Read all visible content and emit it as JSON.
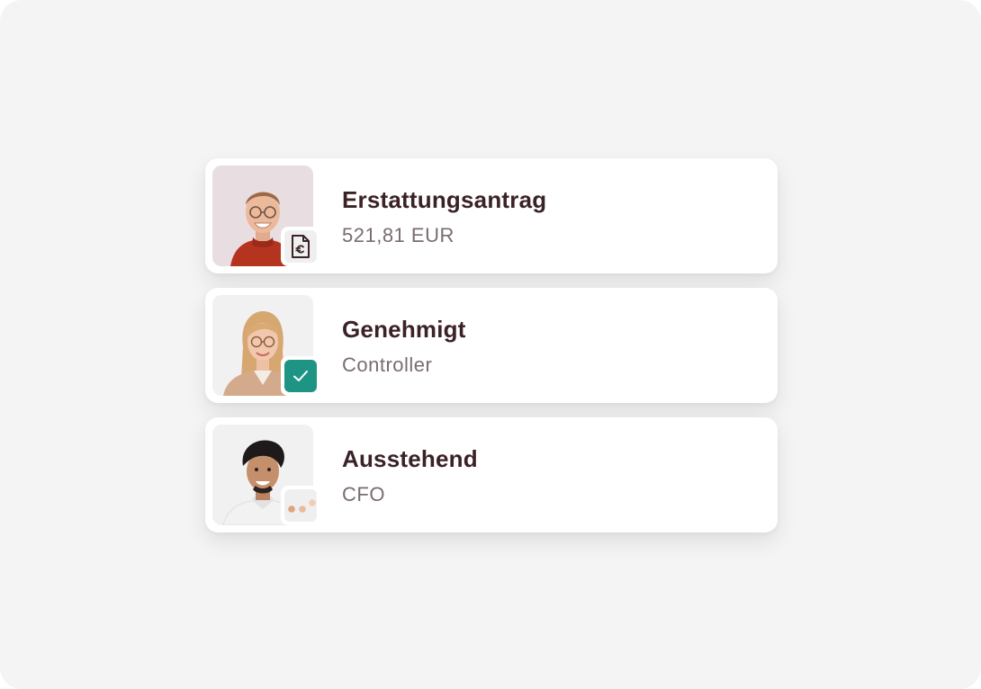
{
  "colors": {
    "page_background": "#f4f4f4",
    "card_background": "#ffffff",
    "title_text": "#3a2226",
    "subtitle_text": "#7a6c6f",
    "approved_badge": "#1e9484",
    "neutral_badge": "#efefef",
    "pending_dots": "#e0a27f"
  },
  "cards": [
    {
      "title": "Erstattungsantrag",
      "subtitle": "521,81 EUR",
      "badge_icon": "euro-document-icon",
      "avatar": "avatar-man-glasses"
    },
    {
      "title": "Genehmigt",
      "subtitle": "Controller",
      "badge_icon": "check-icon",
      "avatar": "avatar-woman-glasses"
    },
    {
      "title": "Ausstehend",
      "subtitle": "CFO",
      "badge_icon": "pending-dots-icon",
      "avatar": "avatar-man-dark-hair"
    }
  ]
}
